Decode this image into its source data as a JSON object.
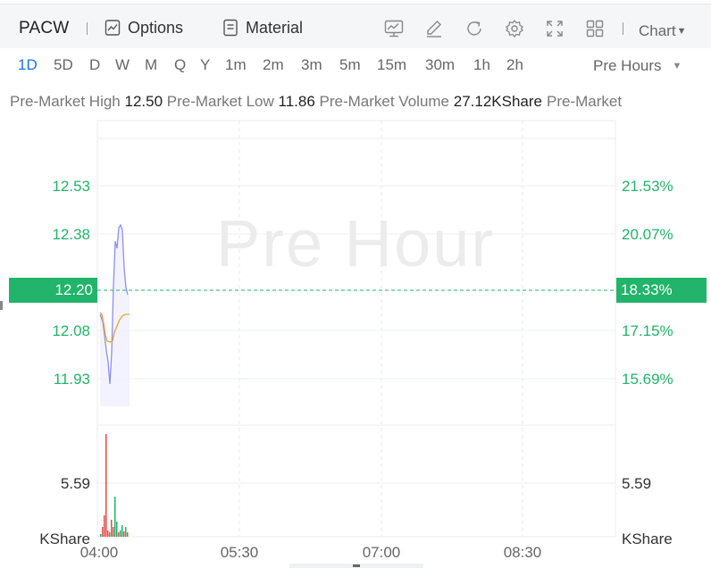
{
  "toolbar": {
    "symbol": "PACW",
    "options_label": "Options",
    "material_label": "Material",
    "chart_label": "Chart",
    "tools": [
      "indicator-icon",
      "draw-icon",
      "refresh-icon",
      "settings-icon",
      "fullscreen-icon",
      "layout-icon"
    ]
  },
  "periods": [
    "1D",
    "5D",
    "D",
    "W",
    "M",
    "Q",
    "Y",
    "1m",
    "2m",
    "3m",
    "5m",
    "15m",
    "30m",
    "1h",
    "2h"
  ],
  "active_period": "1D",
  "session_select": "Pre Hours",
  "stats": {
    "high_label": "Pre-Market High",
    "high_value": "12.50",
    "low_label": "Pre-Market Low",
    "low_value": "11.86",
    "volume_label": "Pre-Market Volume",
    "volume_value": "27.12KShare",
    "cut_label": "Pre-Market"
  },
  "chart": {
    "watermark": "Pre Hour",
    "price_ticks_left": [
      "12.53",
      "12.38",
      "12.08",
      "11.93"
    ],
    "percent_ticks_right": [
      "21.53%",
      "20.07%",
      "17.15%",
      "15.69%"
    ],
    "current_price": "12.20",
    "current_percent": "18.33%",
    "volume_tick_left": "5.59",
    "volume_tick_right": "5.59",
    "volume_unit_left": "KShare",
    "volume_unit_right": "KShare",
    "time_ticks": [
      "04:00",
      "05:30",
      "07:00",
      "08:30"
    ],
    "colors": {
      "up": "#21b46a",
      "down": "#e84a4a",
      "price_line": "#8d8ff0",
      "avg_line": "#f0a030",
      "active_tab": "#1a73e8"
    }
  }
}
